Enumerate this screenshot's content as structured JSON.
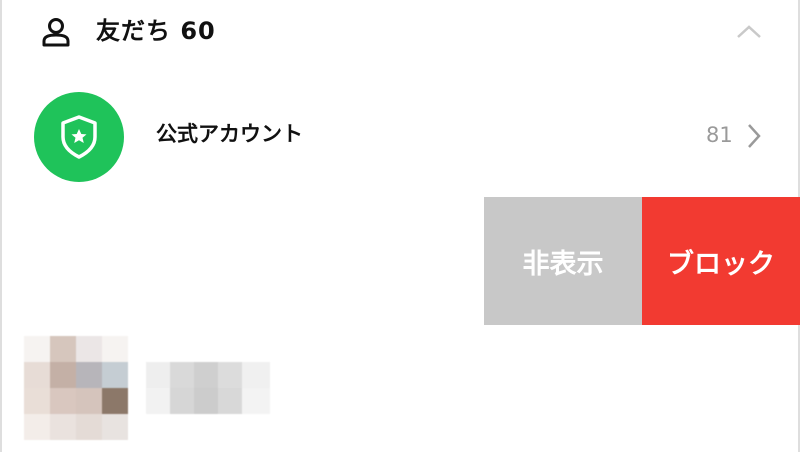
{
  "friends_section": {
    "title": "友だち 60",
    "person_icon": "person-outline-icon",
    "collapse_icon": "chevron-up-icon"
  },
  "official_accounts": {
    "label": "公式アカウント",
    "count": "81",
    "avatar_icon": "shield-star-icon",
    "avatar_color": "#1fc35a",
    "arrow_icon": "chevron-right-icon"
  },
  "swipe_actions": {
    "hide_label": "非表示",
    "hide_color": "#c8c8c8",
    "block_label": "ブロック",
    "block_color": "#f23a31"
  },
  "friend_item": {
    "avatar": "pixelated-avatar",
    "name": "pixelated-name"
  }
}
